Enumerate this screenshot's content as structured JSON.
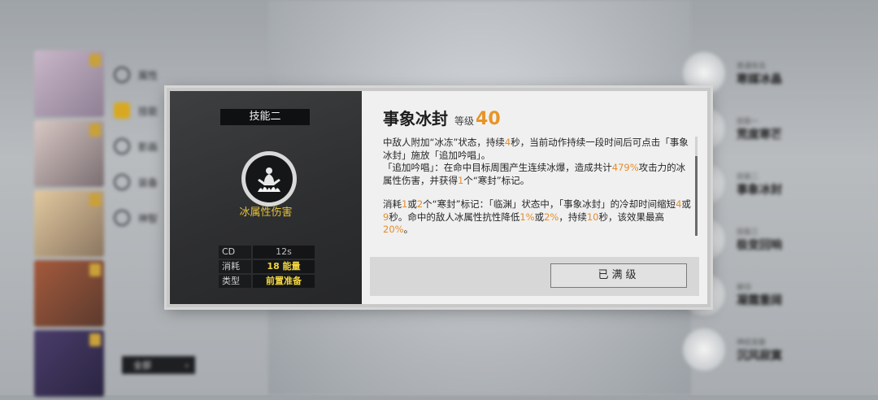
{
  "background": {
    "side_menu": [
      {
        "label": "属性",
        "icon": "stats-icon",
        "active": false
      },
      {
        "label": "技能",
        "icon": "skill-icon",
        "active": true
      },
      {
        "label": "影画",
        "icon": "gallery-icon",
        "active": false
      },
      {
        "label": "装备",
        "icon": "gear-icon",
        "active": false
      },
      {
        "label": "神智",
        "icon": "neuro-icon",
        "active": false
      }
    ],
    "filter_label": "全部",
    "right_list": [
      {
        "sub": "普通攻击",
        "name": "寒媒冰晶"
      },
      {
        "sub": "技能一",
        "name": "荒度寒芒"
      },
      {
        "sub": "技能二",
        "name": "事象冰封"
      },
      {
        "sub": "技能三",
        "name": "极变回响"
      },
      {
        "sub": "被动",
        "name": "凝霜重阔"
      },
      {
        "sub": "神经发散",
        "name": "沉风寂寞"
      }
    ]
  },
  "modal": {
    "skill_slot": "技能二",
    "damage_type": "冰属性伤害",
    "stats": [
      {
        "key": "CD",
        "value": "12s",
        "highlight": false
      },
      {
        "key": "消耗",
        "value": "18 能量",
        "highlight": true
      },
      {
        "key": "类型",
        "value": "前置准备",
        "highlight": true
      }
    ],
    "skill_name": "事象冰封",
    "level_label": "等级",
    "level": "40",
    "description": {
      "p1": [
        "中敌人附加“冰冻”状态，持续",
        "4",
        "秒，当前动作持续一段时间后可点击「事象冰封」施放「追加吟唱」。"
      ],
      "p2": [
        "「追加吟唱」：在命中目标周围产生连续冰爆，造成共计",
        "479%",
        "攻击力的冰属性伤害，并获得",
        "1",
        "个“寒封”标记。"
      ],
      "p3": [
        "消耗",
        "1",
        "或",
        "2",
        "个“寒封”标记：「临渊」状态中，「事象冰封」的冷却时间缩短",
        "4",
        "或",
        "9",
        "秒。命中的敌人冰属性抗性降低",
        "1%",
        "或",
        "2%",
        "，持续",
        "10",
        "秒，该效果最高",
        "20%",
        "。"
      ]
    },
    "max_button_label": "已满级"
  }
}
